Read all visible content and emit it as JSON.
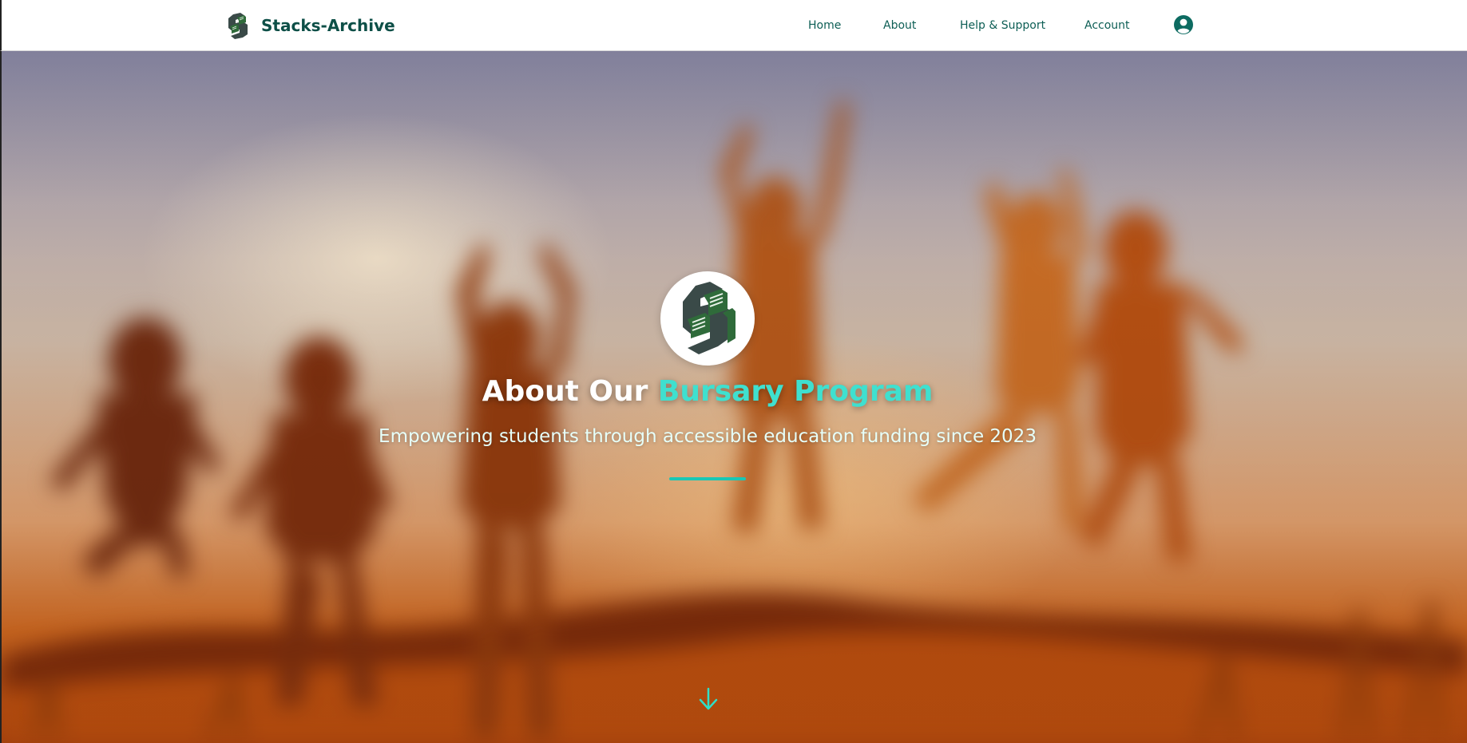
{
  "header": {
    "brand_name": "Stacks-Archive",
    "nav": [
      "Home",
      "About",
      "Help & Support",
      "Account"
    ],
    "account_icon": "user-circle-icon",
    "brand_icon": "stacks-archive-logo"
  },
  "hero": {
    "title_prefix": "About Our ",
    "title_accent": "Bursary Program",
    "subtitle": "Empowering students through accessible education funding since 2023",
    "badge_icon": "stacks-archive-logo",
    "scroll_icon": "arrow-down-icon"
  },
  "colors": {
    "brand_text": "#0d4f47",
    "nav_text": "#0d5e55",
    "accent": "#3fe0cf",
    "divider": "#19c7b5",
    "logo_green": "#2f6b3a",
    "logo_slate": "#3a4a48"
  }
}
